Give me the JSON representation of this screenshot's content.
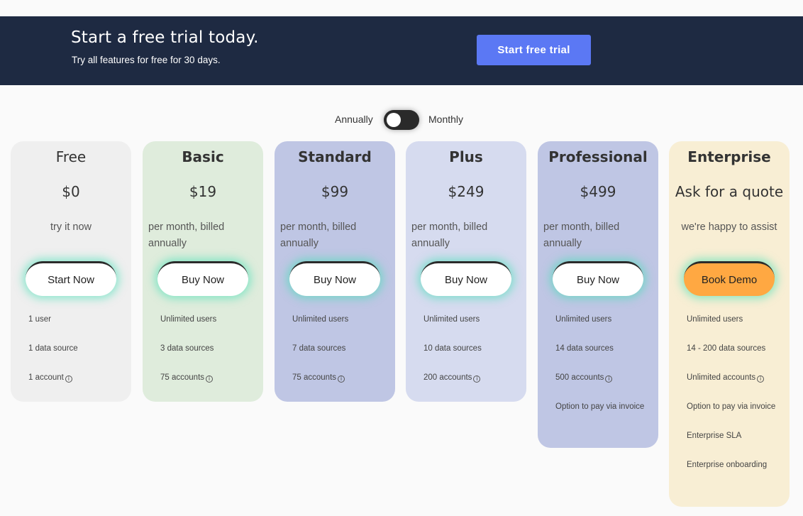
{
  "banner": {
    "title": "Start a free trial today.",
    "subtitle": "Try all features for free for 30 days.",
    "button_label": "Start free trial"
  },
  "billing_toggle": {
    "left_label": "Annually",
    "right_label": "Monthly",
    "selected": "Annually"
  },
  "plans": [
    {
      "name": "Free",
      "price": "$0",
      "note": "try it now",
      "button_label": "Start Now",
      "color": "#efefef",
      "features": [
        "1 user",
        "1 data source",
        "1 account"
      ]
    },
    {
      "name": "Basic",
      "price": "$19",
      "note": "per month, billed annually",
      "button_label": "Buy Now",
      "color": "#dfecdc",
      "features": [
        "Unlimited users",
        "3 data sources",
        "75 accounts"
      ]
    },
    {
      "name": "Standard",
      "price": "$99",
      "note": "per month, billed annually",
      "button_label": "Buy Now",
      "color": "#bfc6e4",
      "features": [
        "Unlimited users",
        "7 data sources",
        "75 accounts"
      ]
    },
    {
      "name": "Plus",
      "price": "$249",
      "note": "per month, billed annually",
      "button_label": "Buy Now",
      "color": "#d6dbef",
      "features": [
        "Unlimited users",
        "10 data sources",
        "200 accounts"
      ]
    },
    {
      "name": "Professional",
      "price": "$499",
      "note": "per month, billed annually",
      "button_label": "Buy Now",
      "color": "#bfc6e4",
      "features": [
        "Unlimited users",
        "14 data sources",
        "500 accounts",
        "Option to pay via invoice"
      ]
    },
    {
      "name": "Enterprise",
      "price": "Ask for a quote",
      "note": "we're happy to assist",
      "button_label": "Book Demo",
      "color": "#f8eed4",
      "features": [
        "Unlimited users",
        "14 - 200 data sources",
        "Unlimited accounts",
        "Option to pay via invoice",
        "Enterprise SLA",
        "Enterprise onboarding"
      ]
    }
  ],
  "icons": {
    "info": "info-circle-icon"
  }
}
